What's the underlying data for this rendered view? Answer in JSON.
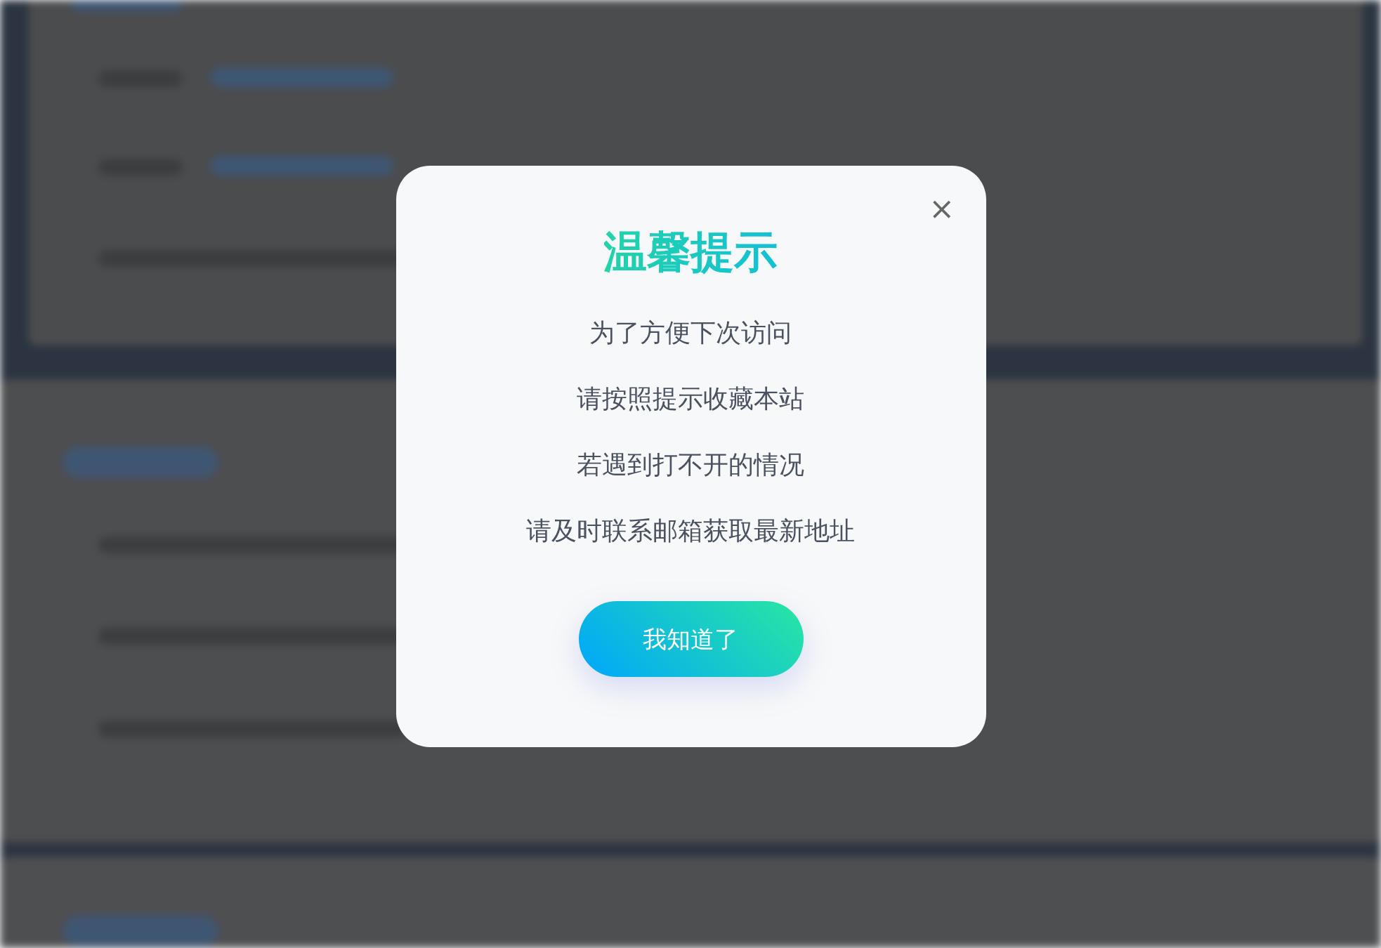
{
  "dialog": {
    "close": "×",
    "title": "温馨提示",
    "lines": [
      "为了方便下次访问",
      "请按照提示收藏本站",
      "若遇到打不开的情况",
      "请及时联系邮箱获取最新地址"
    ],
    "button": "我知道了"
  }
}
